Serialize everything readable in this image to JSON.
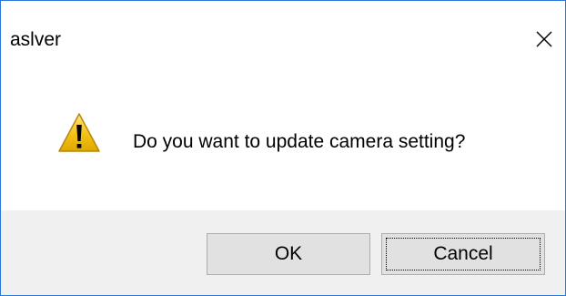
{
  "dialog": {
    "title": "aslver",
    "close_icon": "close-icon",
    "message": "Do you want to update camera setting?",
    "icon": "warning-icon",
    "buttons": {
      "ok_label": "OK",
      "cancel_label": "Cancel"
    },
    "focused_button": "Cancel"
  },
  "colors": {
    "window_border": "#2b79d7",
    "footer_background": "#f0f0f0",
    "button_background": "#e1e1e1",
    "button_border": "#adadad",
    "warning_fill": "#f5c518"
  }
}
